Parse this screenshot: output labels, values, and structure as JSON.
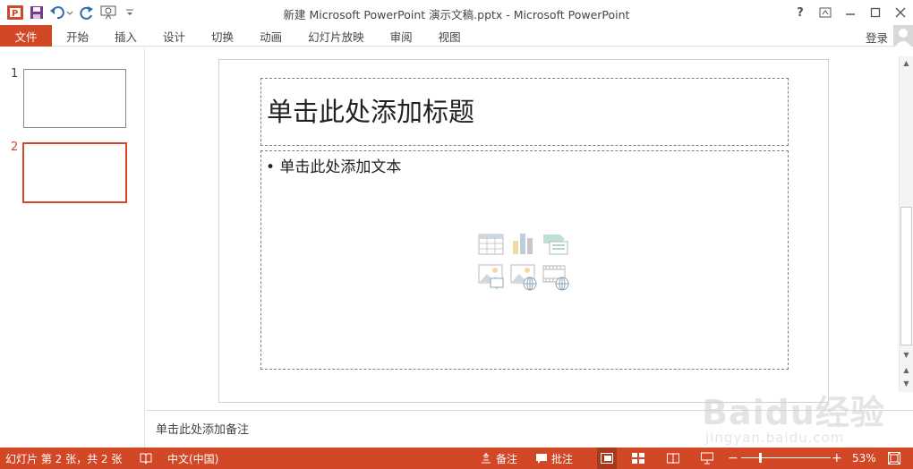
{
  "window": {
    "title": "新建 Microsoft PowerPoint 演示文稿.pptx - Microsoft PowerPoint",
    "help": "?",
    "controls": [
      "restore-ribbon",
      "minimize",
      "maximize",
      "close"
    ]
  },
  "quick_access": {
    "icons": [
      "powerpoint-logo-icon",
      "save-icon",
      "undo-icon",
      "redo-icon",
      "present-icon",
      "customize-icon"
    ]
  },
  "ribbon": {
    "file_tab": "文件",
    "tabs": [
      "开始",
      "插入",
      "设计",
      "切换",
      "动画",
      "幻灯片放映",
      "审阅",
      "视图"
    ],
    "sign_in": "登录"
  },
  "thumbnails": [
    {
      "number": "1",
      "selected": false
    },
    {
      "number": "2",
      "selected": true
    }
  ],
  "slide": {
    "title_placeholder": "单击此处添加标题",
    "body_placeholder": "• 单击此处添加文本",
    "content_icons": [
      "table-icon",
      "chart-icon",
      "smartart-icon",
      "picture-icon",
      "online-picture-icon",
      "video-icon"
    ]
  },
  "notes": {
    "placeholder": "单击此处添加备注"
  },
  "status": {
    "slide_info": "幻灯片 第 2 张，共 2 张",
    "language": "中文(中国)",
    "notes_btn": "备注",
    "comments_btn": "批注",
    "zoom": "53%",
    "zoom_minus": "−",
    "zoom_plus": "+"
  },
  "colors": {
    "accent": "#d24726"
  },
  "watermark": {
    "logo": "Baidu经验",
    "url": "jingyan.baidu.com"
  }
}
